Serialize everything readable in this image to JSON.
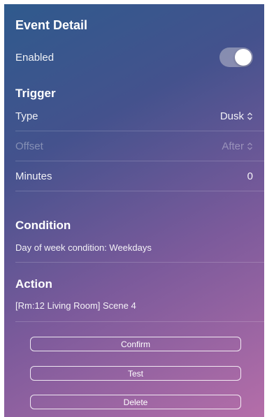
{
  "header": {
    "title": "Event Detail"
  },
  "enabled": {
    "label": "Enabled",
    "on": true
  },
  "trigger": {
    "title": "Trigger",
    "type": {
      "label": "Type",
      "value": "Dusk"
    },
    "offset": {
      "label": "Offset",
      "value": "After"
    },
    "minutes": {
      "label": "Minutes",
      "value": "0"
    }
  },
  "condition": {
    "title": "Condition",
    "text": "Day of week condition: Weekdays"
  },
  "action": {
    "title": "Action",
    "text": "[Rm:12 Living Room] Scene 4"
  },
  "buttons": {
    "confirm": "Confirm",
    "test": "Test",
    "delete": "Delete"
  },
  "colors": {
    "gradient_start": "#2f5a8d",
    "gradient_end": "#b56ea9"
  },
  "icons": {
    "select": "chevron-up-down-icon"
  }
}
